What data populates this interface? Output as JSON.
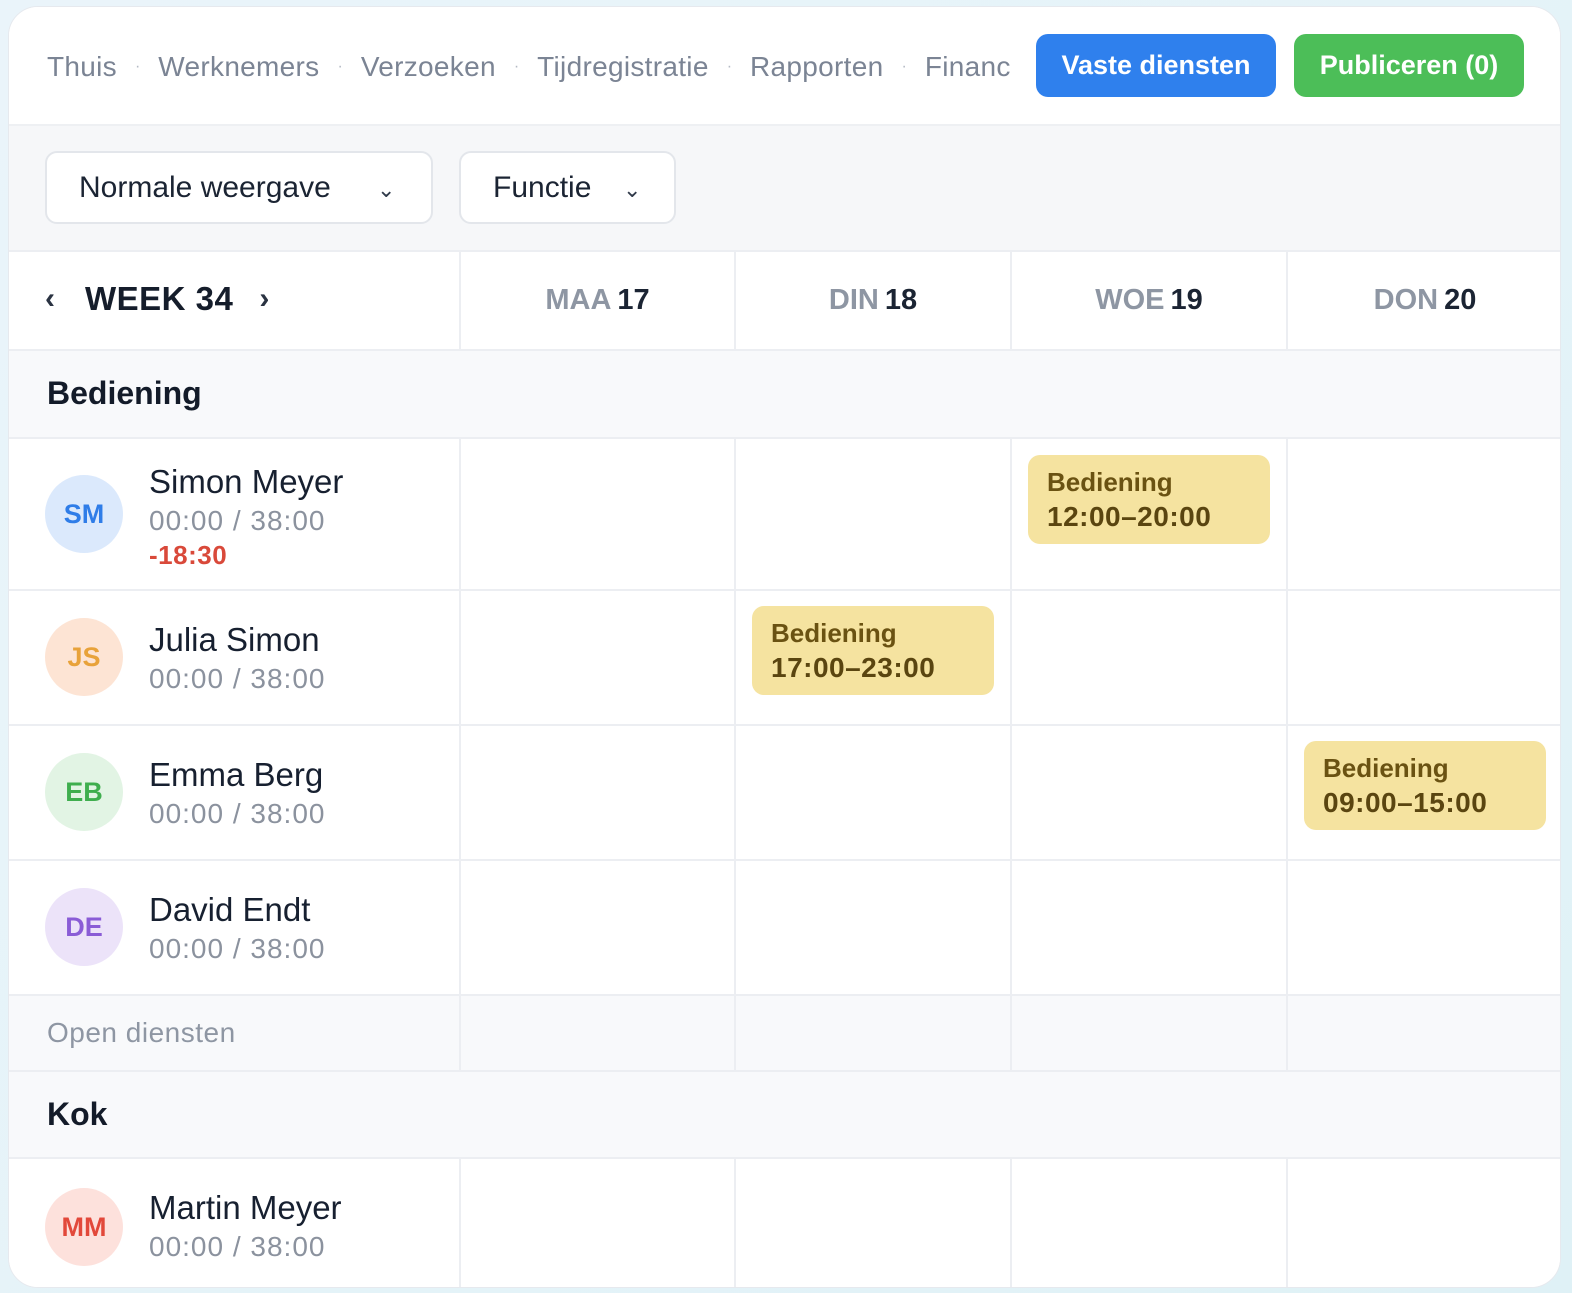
{
  "nav": {
    "items": [
      "Thuis",
      "Werknemers",
      "Verzoeken",
      "Tijdregistratie",
      "Rapporten",
      "Financiën"
    ],
    "separator": "·"
  },
  "actions": {
    "fixed_shifts": "Vaste diensten",
    "publish": "Publiceren (0)"
  },
  "filters": {
    "view": "Normale weergave",
    "function": "Functie",
    "chevron": "⌄"
  },
  "calendar": {
    "prev": "‹",
    "next": "›",
    "week_label": "WEEK 34",
    "days": [
      {
        "name": "MAA",
        "date": "17"
      },
      {
        "name": "DIN",
        "date": "18"
      },
      {
        "name": "WOE",
        "date": "19"
      },
      {
        "name": "DON",
        "date": "20"
      }
    ]
  },
  "groups": [
    {
      "title": "Bediening",
      "employees": [
        {
          "initials": "SM",
          "name": "Simon Meyer",
          "hours": "00:00 / 38:00",
          "balance": "-18:30",
          "avatar_bg": "#dbe9fc",
          "avatar_fg": "#2f7de8",
          "shift": {
            "function": "Bediening",
            "time": "12:00–20:00"
          }
        },
        {
          "initials": "JS",
          "name": "Julia Simon",
          "hours": "00:00 / 38:00",
          "avatar_bg": "#fde4d4",
          "avatar_fg": "#e8a23a",
          "shift": {
            "function": "Bediening",
            "time": "17:00–23:00"
          }
        },
        {
          "initials": "EB",
          "name": "Emma Berg",
          "hours": "00:00 / 38:00",
          "avatar_bg": "#e2f4e4",
          "avatar_fg": "#3fae4e",
          "shift": {
            "function": "Bediening",
            "time": "09:00–15:00"
          }
        },
        {
          "initials": "DE",
          "name": "David Endt",
          "hours": "00:00 / 38:00",
          "avatar_bg": "#ece3f9",
          "avatar_fg": "#8a5cd6"
        }
      ],
      "open_label": "Open diensten"
    },
    {
      "title": "Kok",
      "employees": [
        {
          "initials": "MM",
          "name": "Martin Meyer",
          "hours": "00:00 / 38:00",
          "avatar_bg": "#fde1dc",
          "avatar_fg": "#e2483a"
        }
      ]
    }
  ],
  "colors": {
    "primary": "#2f80ed",
    "success": "#4cbe58",
    "shift_bg": "#f5e3a0",
    "negative": "#d9493a"
  }
}
